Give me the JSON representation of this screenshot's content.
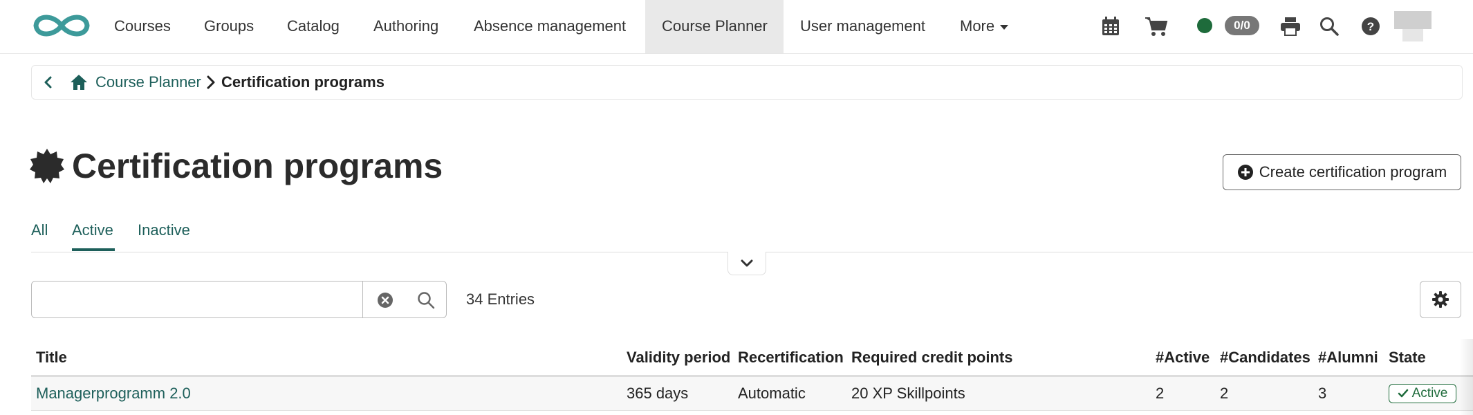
{
  "nav": {
    "items": [
      {
        "label": "Courses"
      },
      {
        "label": "Groups"
      },
      {
        "label": "Catalog"
      },
      {
        "label": "Authoring"
      },
      {
        "label": "Absence management"
      },
      {
        "label": "Course Planner",
        "active": true
      },
      {
        "label": "User management"
      },
      {
        "label": "More"
      }
    ],
    "badge": "0/0",
    "icons": [
      "calendar-icon",
      "cart-icon",
      "status-dot",
      "print-icon",
      "search-icon",
      "help-icon",
      "avatar"
    ]
  },
  "breadcrumb": {
    "link": "Course Planner",
    "current": "Certification programs"
  },
  "page": {
    "title": "Certification programs",
    "create_button": "Create certification program"
  },
  "tabs": [
    {
      "label": "All"
    },
    {
      "label": "Active",
      "active": true
    },
    {
      "label": "Inactive"
    }
  ],
  "search": {
    "value": "",
    "placeholder": ""
  },
  "entries": "34 Entries",
  "table": {
    "headers": [
      "Title",
      "Validity period",
      "Recertification",
      "Required credit points",
      "#Active",
      "#Candidates",
      "#Alumni",
      "State"
    ],
    "rows": [
      {
        "title": "Managerprogramm 2.0",
        "validity": "365 days",
        "recertification": "Automatic",
        "credit_points": "20 XP Skillpoints",
        "active": "2",
        "candidates": "2",
        "alumni": "3",
        "state": "Active"
      }
    ]
  },
  "colors": {
    "accent": "#1d5f5a",
    "status_green": "#1e6b3b",
    "logo": "#3d9a9a"
  }
}
